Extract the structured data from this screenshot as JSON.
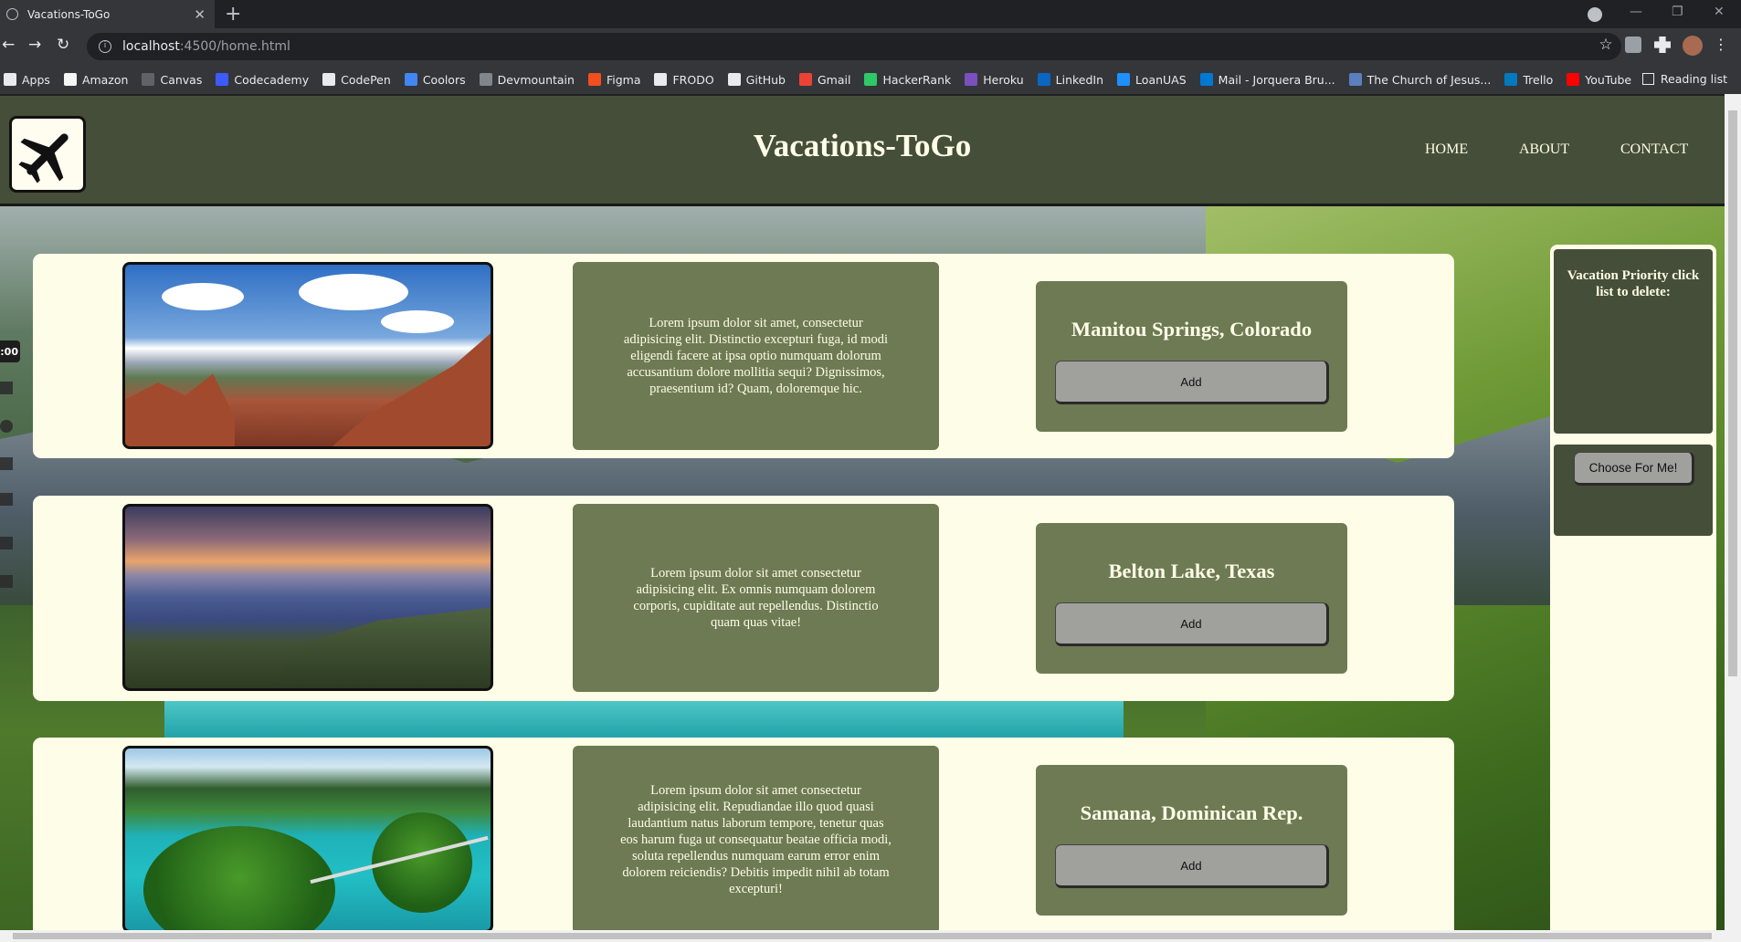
{
  "browser": {
    "tab_title": "Vacations-ToGo",
    "tab_close": "✕",
    "new_tab": "+",
    "url_host": "localhost",
    "url_path": ":4500/home.html",
    "bookmarks": [
      "Apps",
      "Amazon",
      "Canvas",
      "Codecademy",
      "CodePen",
      "Coolors",
      "Devmountain",
      "Figma",
      "FRODO",
      "GitHub",
      "Gmail",
      "HackerRank",
      "Heroku",
      "LinkedIn",
      "LoanUAS",
      "Mail - Jorquera Bru...",
      "The Church of Jesus...",
      "Trello",
      "YouTube"
    ],
    "reading_list": "Reading list"
  },
  "header": {
    "title": "Vacations-ToGo",
    "nav": [
      "HOME",
      "ABOUT",
      "CONTACT"
    ]
  },
  "cards": [
    {
      "description": "Lorem ipsum dolor sit amet, consectetur adipisicing elit. Distinctio excepturi fuga, id modi eligendi facere at ipsa optio numquam dolorum accusantium dolore mollitia sequi? Dignissimos, praesentium id? Quam, doloremque hic.",
      "destination": "Manitou Springs, Colorado",
      "button": "Add"
    },
    {
      "description": "Lorem ipsum dolor sit amet consectetur adipisicing elit. Ex omnis numquam dolorem corporis, cupiditate aut repellendus. Distinctio quam quas vitae!",
      "destination": "Belton Lake, Texas",
      "button": "Add"
    },
    {
      "description": "Lorem ipsum dolor sit amet consectetur adipisicing elit. Repudiandae illo quod quasi laudantium natus laborum tempore, tenetur quas eos harum fuga ut consequatur beatae officia modi, soluta repellendus numquam earum error enim dolorem reiciendis? Debitis impedit nihil ab totam excepturi!",
      "destination": "Samana, Dominican Rep.",
      "button": "Add"
    }
  ],
  "sidebar": {
    "title": "Vacation Priority click list to delete:",
    "choose_button": "Choose For Me!"
  },
  "recorder": {
    "time": ":00"
  }
}
